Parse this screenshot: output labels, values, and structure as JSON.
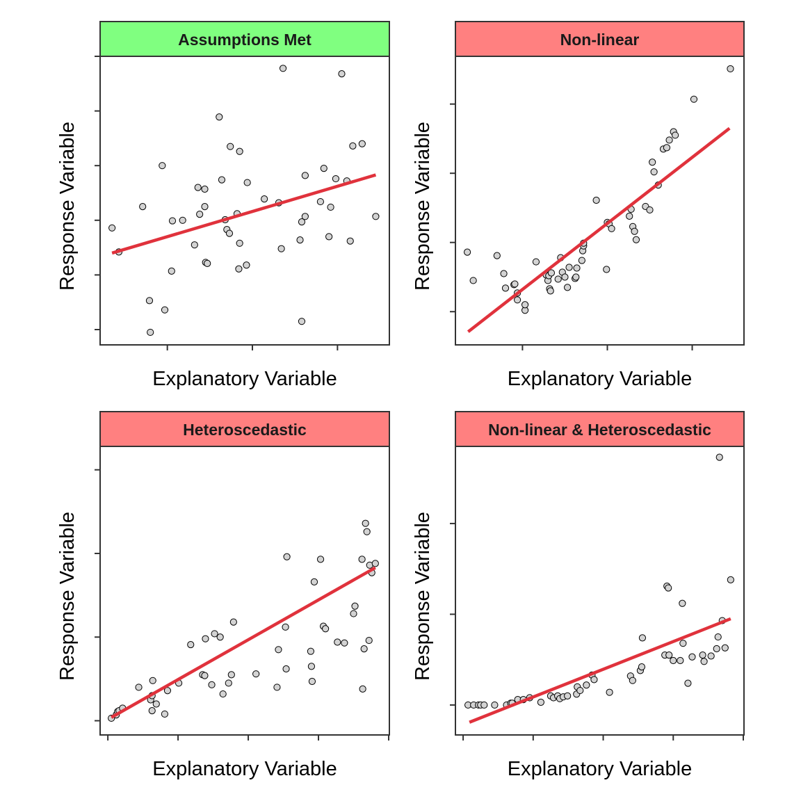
{
  "colors": {
    "strip_pass": "#80ff80",
    "strip_fail": "#ff8080",
    "fit_line": "#e0323c",
    "point_fill": "#d3d3d3",
    "point_stroke": "#000000",
    "frame": "#333333"
  },
  "chart_data": [
    {
      "type": "scatter",
      "panel": "top-left",
      "title": "Assumptions Met",
      "status": "pass",
      "xlabel": "Explanatory Variable",
      "ylabel": "Response Variable",
      "xlim": [
        0.21,
        3.61
      ],
      "ylim": [
        -0.28,
        5.0
      ],
      "xticks": [
        1,
        2,
        3
      ],
      "yticks": [
        0,
        1,
        2,
        3,
        4,
        5
      ],
      "tick_labels_shown": false,
      "grid": false,
      "fit_line": {
        "x": [
          0.35,
          3.45
        ],
        "y": [
          1.4,
          2.83
        ]
      },
      "points": {
        "x": [
          0.35,
          0.43,
          0.71,
          0.79,
          0.8,
          0.94,
          0.97,
          1.05,
          1.06,
          1.18,
          1.32,
          1.36,
          1.38,
          1.44,
          1.44,
          1.45,
          1.47,
          1.61,
          1.64,
          1.68,
          1.7,
          1.73,
          1.74,
          1.82,
          1.84,
          1.85,
          1.85,
          1.93,
          1.94,
          2.14,
          2.31,
          2.34,
          2.36,
          2.56,
          2.58,
          2.58,
          2.62,
          2.62,
          2.8,
          2.84,
          2.9,
          2.92,
          2.98,
          3.05,
          3.11,
          3.15,
          3.18,
          3.29,
          3.45
        ],
        "y": [
          1.86,
          1.42,
          2.25,
          0.53,
          -0.05,
          3.0,
          0.36,
          1.07,
          1.99,
          2.0,
          1.55,
          2.6,
          2.11,
          2.57,
          2.25,
          1.23,
          1.21,
          3.89,
          2.74,
          2.01,
          1.83,
          1.76,
          3.35,
          2.12,
          1.11,
          3.26,
          1.58,
          1.18,
          2.69,
          2.39,
          2.32,
          1.48,
          4.78,
          1.64,
          1.97,
          0.15,
          2.07,
          2.82,
          2.34,
          2.95,
          1.7,
          2.24,
          2.76,
          4.68,
          2.72,
          1.62,
          3.36,
          3.4,
          2.07
        ]
      }
    },
    {
      "type": "scatter",
      "panel": "top-right",
      "title": "Non-linear",
      "status": "fail",
      "xlabel": "Explanatory Variable",
      "ylabel": "Response Variable",
      "xlim": [
        0.21,
        3.61
      ],
      "ylim": [
        -0.48,
        3.69
      ],
      "xticks": [
        1,
        2,
        3
      ],
      "yticks": [
        0,
        1,
        2,
        3
      ],
      "tick_labels_shown": false,
      "grid": false,
      "fit_line": {
        "x": [
          0.36,
          3.44
        ],
        "y": [
          -0.29,
          2.65
        ]
      },
      "points": {
        "x": [
          0.35,
          0.42,
          0.7,
          0.78,
          0.8,
          0.9,
          0.91,
          0.94,
          0.94,
          1.03,
          1.03,
          1.16,
          1.28,
          1.3,
          1.31,
          1.32,
          1.33,
          1.34,
          1.42,
          1.45,
          1.47,
          1.5,
          1.53,
          1.55,
          1.62,
          1.63,
          1.64,
          1.7,
          1.71,
          1.72,
          1.72,
          1.87,
          1.99,
          2.0,
          2.02,
          2.05,
          2.26,
          2.28,
          2.3,
          2.32,
          2.34,
          2.45,
          2.5,
          2.53,
          2.55,
          2.6,
          2.66,
          2.7,
          2.73,
          2.78,
          2.8,
          3.02,
          3.45
        ],
        "y": [
          0.86,
          0.45,
          0.81,
          0.55,
          0.34,
          0.39,
          0.4,
          0.27,
          0.17,
          0.02,
          0.1,
          0.72,
          0.53,
          0.45,
          0.52,
          0.33,
          0.3,
          0.56,
          0.47,
          0.78,
          0.57,
          0.5,
          0.35,
          0.64,
          0.48,
          0.5,
          0.63,
          0.74,
          0.88,
          0.95,
          0.99,
          1.61,
          0.61,
          1.29,
          1.27,
          1.2,
          1.38,
          1.48,
          1.23,
          1.16,
          1.04,
          1.52,
          1.47,
          2.16,
          2.02,
          1.83,
          2.35,
          2.37,
          2.48,
          2.6,
          2.55,
          3.07,
          3.51
        ]
      }
    },
    {
      "type": "scatter",
      "panel": "bottom-left",
      "title": "Heteroscedastic",
      "status": "fail",
      "xlabel": "Explanatory Variable",
      "ylabel": "Response Variable",
      "xlim": [
        -0.11,
        4.01
      ],
      "ylim": [
        -0.17,
        3.28
      ],
      "xticks": [
        0,
        1,
        2,
        3,
        4
      ],
      "yticks": [
        0,
        1,
        2,
        3
      ],
      "tick_labels_shown": false,
      "grid": false,
      "fit_line": {
        "x": [
          0.05,
          3.81
        ],
        "y": [
          0.04,
          1.83
        ]
      },
      "points": {
        "x": [
          0.05,
          0.12,
          0.14,
          0.16,
          0.21,
          0.44,
          0.61,
          0.63,
          0.63,
          0.64,
          0.69,
          0.81,
          0.85,
          1.01,
          1.18,
          1.35,
          1.38,
          1.39,
          1.48,
          1.52,
          1.6,
          1.64,
          1.72,
          1.76,
          1.79,
          2.11,
          2.41,
          2.43,
          2.53,
          2.54,
          2.55,
          2.89,
          2.9,
          2.91,
          2.94,
          3.03,
          3.07,
          3.1,
          3.27,
          3.37,
          3.5,
          3.52,
          3.62,
          3.63,
          3.65,
          3.67,
          3.69,
          3.72,
          3.73,
          3.76,
          3.81
        ],
        "y": [
          0.03,
          0.07,
          0.11,
          0.12,
          0.15,
          0.4,
          0.25,
          0.3,
          0.12,
          0.48,
          0.2,
          0.08,
          0.36,
          0.45,
          0.91,
          0.55,
          0.54,
          0.98,
          0.43,
          1.04,
          1.0,
          0.32,
          0.45,
          0.55,
          1.18,
          0.56,
          0.4,
          0.85,
          1.12,
          0.62,
          1.96,
          0.83,
          0.65,
          0.47,
          1.66,
          1.93,
          1.13,
          1.1,
          0.94,
          0.93,
          1.28,
          1.37,
          1.93,
          0.38,
          0.86,
          2.36,
          2.26,
          0.96,
          1.86,
          1.77,
          1.88
        ]
      }
    },
    {
      "type": "scatter",
      "panel": "bottom-right",
      "title": "Non-linear & Heteroscedastic",
      "status": "fail",
      "xlabel": "Explanatory Variable",
      "ylabel": "Response Variable",
      "xlim": [
        -0.11,
        4.01
      ],
      "ylim": [
        -0.33,
        2.85
      ],
      "xticks": [
        0,
        1,
        2,
        3,
        4
      ],
      "yticks": [
        0,
        1,
        2
      ],
      "tick_labels_shown": false,
      "grid": false,
      "fit_line": {
        "x": [
          0.09,
          3.82
        ],
        "y": [
          -0.19,
          0.95
        ]
      },
      "points": {
        "x": [
          0.07,
          0.15,
          0.22,
          0.25,
          0.3,
          0.45,
          0.62,
          0.68,
          0.7,
          0.78,
          0.86,
          0.95,
          1.11,
          1.25,
          1.29,
          1.35,
          1.38,
          1.43,
          1.49,
          1.62,
          1.63,
          1.67,
          1.76,
          1.84,
          1.87,
          2.09,
          2.39,
          2.42,
          2.53,
          2.55,
          2.56,
          2.88,
          2.91,
          2.93,
          2.94,
          3.0,
          3.1,
          3.13,
          3.14,
          3.21,
          3.27,
          3.42,
          3.44,
          3.54,
          3.62,
          3.64,
          3.66,
          3.7,
          3.74,
          3.82
        ],
        "y": [
          0.0,
          0.0,
          0.0,
          0.0,
          0.0,
          0.0,
          0.0,
          0.02,
          0.02,
          0.06,
          0.06,
          0.08,
          0.03,
          0.1,
          0.08,
          0.1,
          0.07,
          0.09,
          0.1,
          0.12,
          0.2,
          0.16,
          0.22,
          0.33,
          0.28,
          0.14,
          0.32,
          0.27,
          0.38,
          0.42,
          0.74,
          0.55,
          1.31,
          1.29,
          0.55,
          0.49,
          0.49,
          1.12,
          0.68,
          0.24,
          0.53,
          0.55,
          0.48,
          0.54,
          0.62,
          0.75,
          2.73,
          0.93,
          0.63,
          1.38
        ]
      }
    }
  ]
}
